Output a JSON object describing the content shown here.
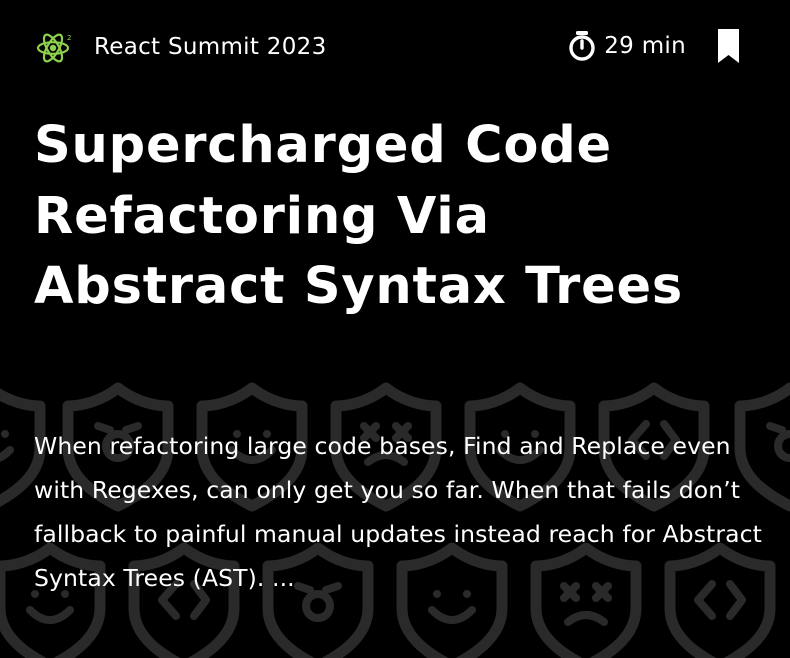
{
  "event": {
    "name": "React Summit 2023",
    "logo_icon": "react-atom-icon",
    "logo_color": "#8ed14f"
  },
  "meta": {
    "duration": "29 min",
    "timer_icon": "stopwatch-icon",
    "bookmark_icon": "bookmark-icon"
  },
  "talk": {
    "title": "Supercharged Code Refactoring Via Abstract Syntax Trees",
    "description": "When refactoring large code bases, Find and Replace even with Regexes, can only get you so far. When that fails don’t fallback to painful manual updates instead reach for Abstract Syntax Trees (AST). ..."
  },
  "theme": {
    "background": "#000000",
    "text": "#ffffff",
    "pattern": "#2a2a2a"
  }
}
